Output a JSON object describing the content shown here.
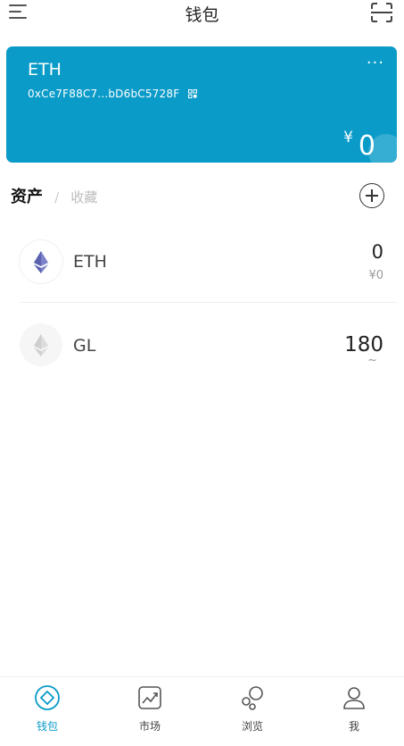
{
  "header": {
    "title": "钱包"
  },
  "wallet": {
    "chain": "ETH",
    "address": "0xCe7F88C7...bD6bC5728F",
    "more": "···",
    "currency": "¥",
    "balance": "0"
  },
  "assets_section": {
    "tab_assets": "资产",
    "separator": "/",
    "tab_favorites": "收藏"
  },
  "assets": [
    {
      "name": "ETH",
      "amount": "0",
      "value": "¥0",
      "icon": "ethereum-logo"
    },
    {
      "name": "GL",
      "amount": "180",
      "value": "~",
      "icon": "ethereum-logo-faded"
    }
  ],
  "bottom_nav": [
    {
      "label": "钱包",
      "icon": "wallet-icon",
      "active": true
    },
    {
      "label": "市场",
      "icon": "market-chart-icon",
      "active": false
    },
    {
      "label": "浏览",
      "icon": "browse-bubbles-icon",
      "active": false
    },
    {
      "label": "我",
      "icon": "profile-icon",
      "active": false
    }
  ],
  "colors": {
    "accent": "#0a9bc8",
    "card": "#0a9bc8",
    "text_muted": "#999999"
  }
}
